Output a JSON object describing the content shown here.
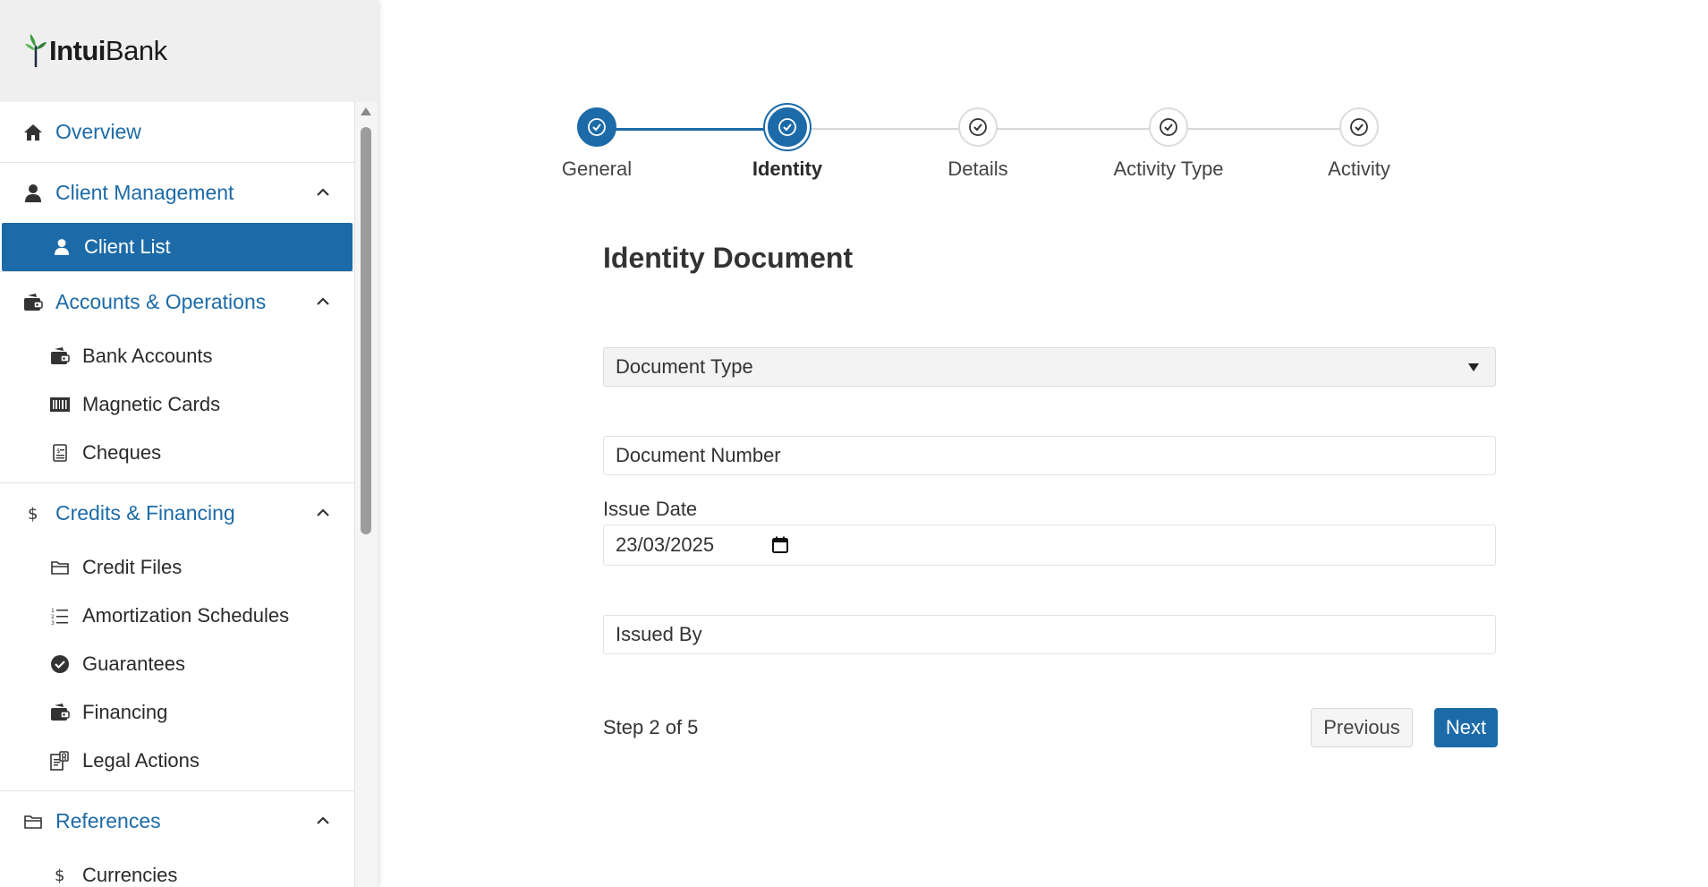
{
  "app": {
    "logo_bold": "Intui",
    "logo_regular": "Bank",
    "accent_color": "#1c6ba8"
  },
  "sidebar": {
    "overview": {
      "label": "Overview",
      "icon": "home-icon"
    },
    "client_management": {
      "label": "Client Management",
      "icon": "user-icon",
      "expanded": true,
      "items": [
        {
          "label": "Client List",
          "icon": "user-icon",
          "active": true
        }
      ]
    },
    "accounts": {
      "label": "Accounts & Operations",
      "icon": "wallet-icon",
      "expanded": true,
      "items": [
        {
          "label": "Bank Accounts",
          "icon": "wallet-icon"
        },
        {
          "label": "Magnetic Cards",
          "icon": "barcode-icon"
        },
        {
          "label": "Cheques",
          "icon": "receipt-icon"
        }
      ]
    },
    "credits": {
      "label": "Credits & Financing",
      "icon": "dollar-icon",
      "expanded": true,
      "items": [
        {
          "label": "Credit Files",
          "icon": "folder-icon"
        },
        {
          "label": "Amortization Schedules",
          "icon": "numbered-list-icon"
        },
        {
          "label": "Guarantees",
          "icon": "check-circle-icon"
        },
        {
          "label": "Financing",
          "icon": "wallet-icon"
        },
        {
          "label": "Legal Actions",
          "icon": "legal-document-icon"
        }
      ]
    },
    "references": {
      "label": "References",
      "icon": "folder-icon",
      "expanded": true,
      "items": [
        {
          "label": "Currencies",
          "icon": "dollar-icon"
        }
      ]
    }
  },
  "stepper": {
    "steps": [
      {
        "label": "General",
        "state": "done"
      },
      {
        "label": "Identity",
        "state": "current"
      },
      {
        "label": "Details",
        "state": "pending"
      },
      {
        "label": "Activity Type",
        "state": "pending"
      },
      {
        "label": "Activity",
        "state": "pending"
      }
    ]
  },
  "form": {
    "title": "Identity Document",
    "document_type": {
      "value": "Document Type"
    },
    "document_number": {
      "placeholder": "Document Number"
    },
    "issue_date": {
      "label": "Issue Date",
      "value": "23/03/2025"
    },
    "issued_by": {
      "placeholder": "Issued By"
    },
    "step_text": "Step 2 of 5",
    "previous_label": "Previous",
    "next_label": "Next"
  }
}
